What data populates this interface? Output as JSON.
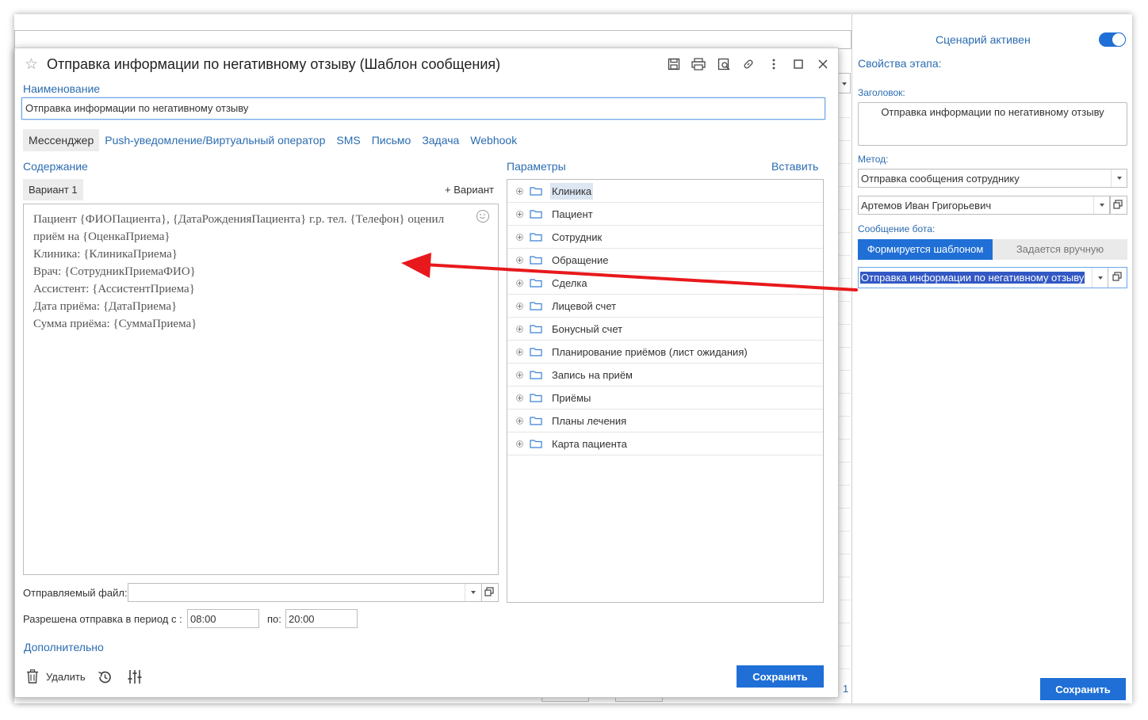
{
  "background": {
    "page_number": "1"
  },
  "right_panel": {
    "scenario_active": "Сценарий активен",
    "section_title": "Свойства этапа:",
    "header_label": "Заголовок:",
    "header_value": "Отправка информации по негативному отзыву",
    "method_label": "Метод:",
    "method_value": "Отправка сообщения сотруднику",
    "employee_value": "Артемов Иван Григорьевич",
    "bot_message_label": "Сообщение бота:",
    "mode_template": "Формируется шаблоном",
    "mode_manual": "Задается вручную",
    "template_value": "Отправка информации по негативному отзыву",
    "save_label": "Сохранить",
    "accent_color": "#1f6fd6"
  },
  "dialog": {
    "title": "Отправка информации по негативному отзыву (Шаблон сообщения)",
    "name_label": "Наименование",
    "name_value": "Отправка информации по негативному отзыву",
    "tabs": [
      {
        "label": "Мессенджер",
        "active": true
      },
      {
        "label": "Push-уведомление/Виртуальный оператор"
      },
      {
        "label": "SMS"
      },
      {
        "label": "Письмо"
      },
      {
        "label": "Задача"
      },
      {
        "label": "Webhook"
      }
    ],
    "content_label": "Содержание",
    "variant_tab": "Вариант 1",
    "add_variant": "+ Вариант",
    "editor_lines": [
      "Пациент {ФИОПациента}, {ДатаРожденияПациента} г.р. тел. {Телефон} оценил",
      "приём на {ОценкаПриема}",
      "Клиника: {КлиникаПриема}",
      "Врач: {СотрудникПриемаФИО}",
      "Ассистент: {АссистентПриема}",
      "Дата приёма: {ДатаПриема}",
      "Сумма приёма: {СуммаПриема}"
    ],
    "params_label": "Параметры",
    "insert_label": "Вставить",
    "params": [
      "Клиника",
      "Пациент",
      "Сотрудник",
      "Обращение",
      "Сделка",
      "Лицевой счет",
      "Бонусный счет",
      "Планирование приёмов (лист ожидания)",
      "Запись на приём",
      "Приёмы",
      "Планы лечения",
      "Карта пациента"
    ],
    "file_label": "Отправляемый файл:",
    "period_label": "Разрешена отправка в период с :",
    "time_from": "08:00",
    "to_label": "по:",
    "time_to": "20:00",
    "additional_label": "Дополнительно",
    "delete_label": "Удалить",
    "save_label": "Сохранить"
  },
  "annotation_color": "#e8191c"
}
